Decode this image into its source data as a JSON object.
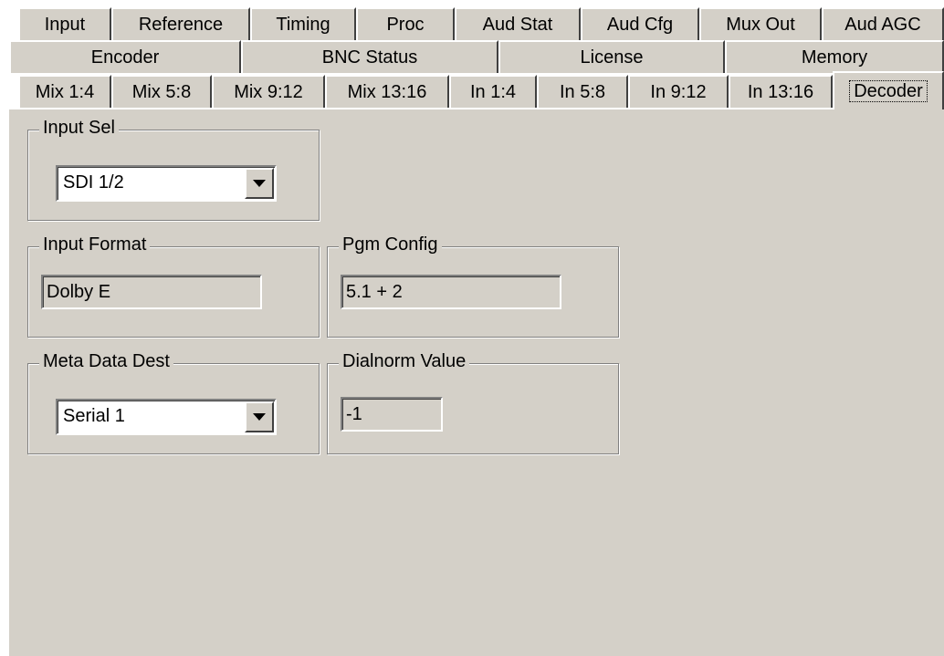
{
  "tabs": {
    "row1": [
      "Input",
      "Reference",
      "Timing",
      "Proc",
      "Aud Stat",
      "Aud Cfg",
      "Mux Out",
      "Aud AGC"
    ],
    "row2": [
      "Encoder",
      "BNC Status",
      "License",
      "Memory"
    ],
    "row3": [
      "Mix 1:4",
      "Mix 5:8",
      "Mix 9:12",
      "Mix 13:16",
      "In 1:4",
      "In 5:8",
      "In 9:12",
      "In 13:16",
      "Decoder"
    ],
    "active": "Decoder"
  },
  "decoder": {
    "input_sel": {
      "label": "Input Sel",
      "value": "SDI 1/2"
    },
    "input_format": {
      "label": "Input Format",
      "value": "Dolby E"
    },
    "pgm_config": {
      "label": "Pgm Config",
      "value": "5.1 + 2"
    },
    "meta_data_dest": {
      "label": "Meta Data Dest",
      "value": "Serial 1"
    },
    "dialnorm_value": {
      "label": "Dialnorm Value",
      "value": "-1"
    }
  }
}
